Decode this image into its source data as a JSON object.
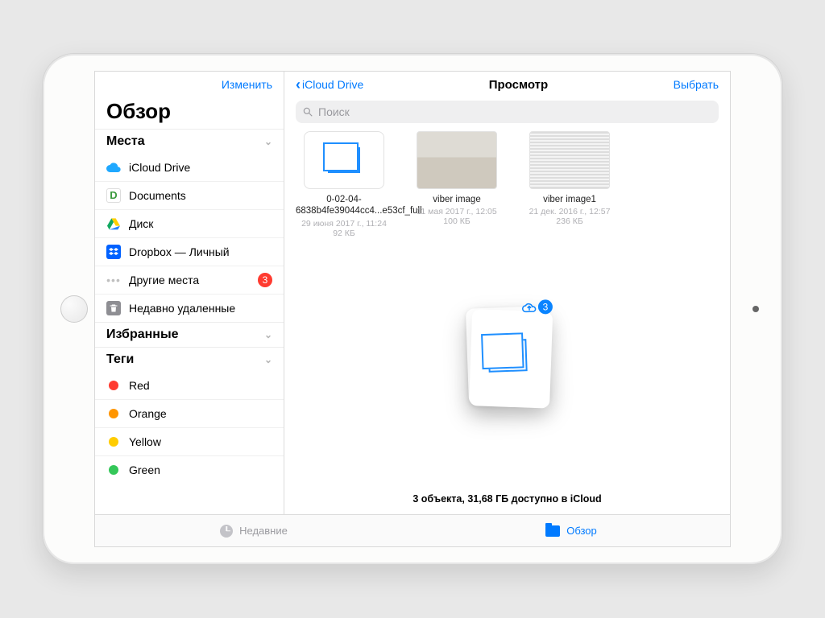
{
  "sidebar": {
    "edit_label": "Изменить",
    "title": "Обзор",
    "sections": {
      "places": {
        "label": "Места"
      },
      "favorites": {
        "label": "Избранные"
      },
      "tags": {
        "label": "Теги"
      }
    },
    "places": [
      {
        "label": "iCloud Drive"
      },
      {
        "label": "Documents"
      },
      {
        "label": "Диск"
      },
      {
        "label": "Dropbox — Личный"
      },
      {
        "label": "Другие места",
        "badge": "3"
      },
      {
        "label": "Недавно удаленные"
      }
    ],
    "tags": [
      {
        "label": "Red",
        "color": "#ff3b30"
      },
      {
        "label": "Orange",
        "color": "#ff9500"
      },
      {
        "label": "Yellow",
        "color": "#ffcc00"
      },
      {
        "label": "Green",
        "color": "#34c759"
      }
    ]
  },
  "main": {
    "back_label": "iCloud Drive",
    "title": "Просмотр",
    "select_label": "Выбрать",
    "search_placeholder": "Поиск",
    "files": [
      {
        "name": "0-02-04-6838b4fe39044cc4...e53cf_full",
        "meta": "29 июня 2017 г., 11:24",
        "size": "92 КБ"
      },
      {
        "name": "viber image",
        "meta": "11 мая 2017 г., 12:05",
        "size": "100 КБ"
      },
      {
        "name": "viber image1",
        "meta": "21 дек. 2016 г., 12:57",
        "size": "236 КБ"
      }
    ],
    "upload_count": "3",
    "status": "3 объекта, 31,68 ГБ доступно в iCloud"
  },
  "tabbar": {
    "recent": "Недавние",
    "browse": "Обзор"
  }
}
